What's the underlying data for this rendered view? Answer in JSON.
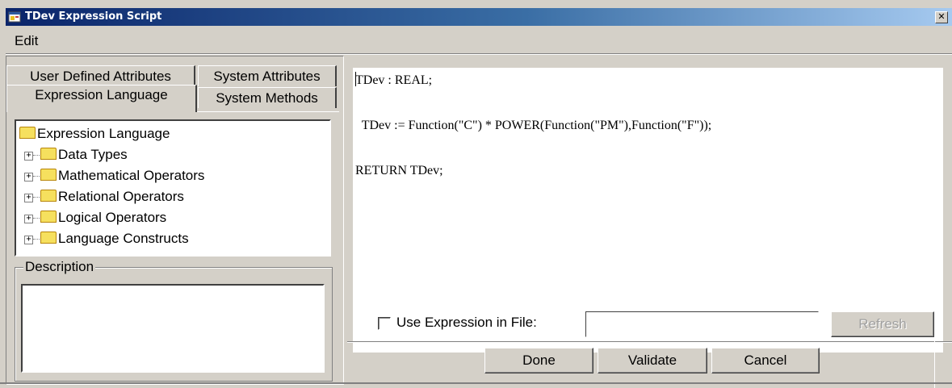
{
  "window": {
    "title": "TDev Expression Script",
    "close_glyph": "✕"
  },
  "menu": {
    "edit": "Edit"
  },
  "tabs": [
    {
      "label": "User Defined Attributes"
    },
    {
      "label": "System Attributes"
    },
    {
      "label": "Expression Language",
      "selected": true
    },
    {
      "label": "System Methods"
    }
  ],
  "tree": {
    "root": "Expression Language",
    "items": [
      "Data Types",
      "Mathematical Operators",
      "Relational Operators",
      "Logical Operators",
      "Language Constructs"
    ],
    "expander_glyph": "+"
  },
  "description": {
    "legend": "Description",
    "text": ""
  },
  "editor": {
    "lines": [
      "TDev : REAL;",
      "  TDev := Function(\"C\") * POWER(Function(\"PM\"),Function(\"F\"));",
      "RETURN TDev;"
    ]
  },
  "file_option": {
    "checkbox_label": "Use Expression in File:",
    "checked": false,
    "file_value": "",
    "refresh_label": "Refresh"
  },
  "buttons": {
    "done": "Done",
    "validate": "Validate",
    "cancel": "Cancel"
  },
  "colors": {
    "face": "#d4d0c8",
    "title_start": "#0a246a",
    "title_end": "#a6caf0"
  },
  "icons": {
    "app": "window-icon",
    "folder": "folder-icon",
    "expander": "plus-box-icon"
  }
}
